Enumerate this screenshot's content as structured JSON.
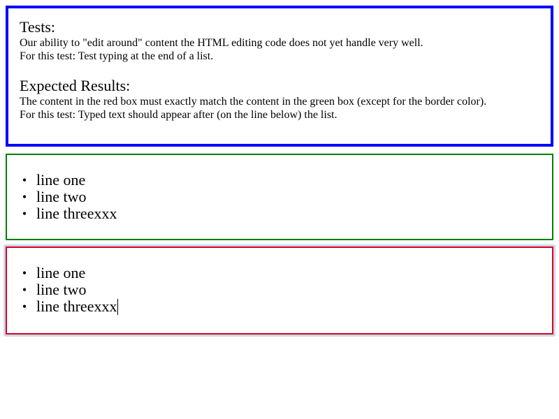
{
  "tests": {
    "title": "Tests:",
    "lines": [
      "Our ability to \"edit around\" content the HTML editing code does not yet handle very well.",
      "For this test: Test typing at the end of a list."
    ]
  },
  "expected_results": {
    "title": "Expected Results:",
    "lines": [
      "The content in the red box must exactly match the content in the green box (except for the border color).",
      "For this test: Typed text should appear after (on the line below) the list."
    ]
  },
  "colors": {
    "tests_border": "#0000ff",
    "expected_border": "#008000",
    "actual_border": "#e0001b",
    "focus_ring": "#c8d9ef"
  },
  "bullet_glyph": "•",
  "expected_list": {
    "items": [
      "line one",
      "line two",
      "line threexxx"
    ]
  },
  "actual_list": {
    "items": [
      "line one",
      "line two",
      "line threexxx"
    ],
    "has_text_caret": true
  }
}
